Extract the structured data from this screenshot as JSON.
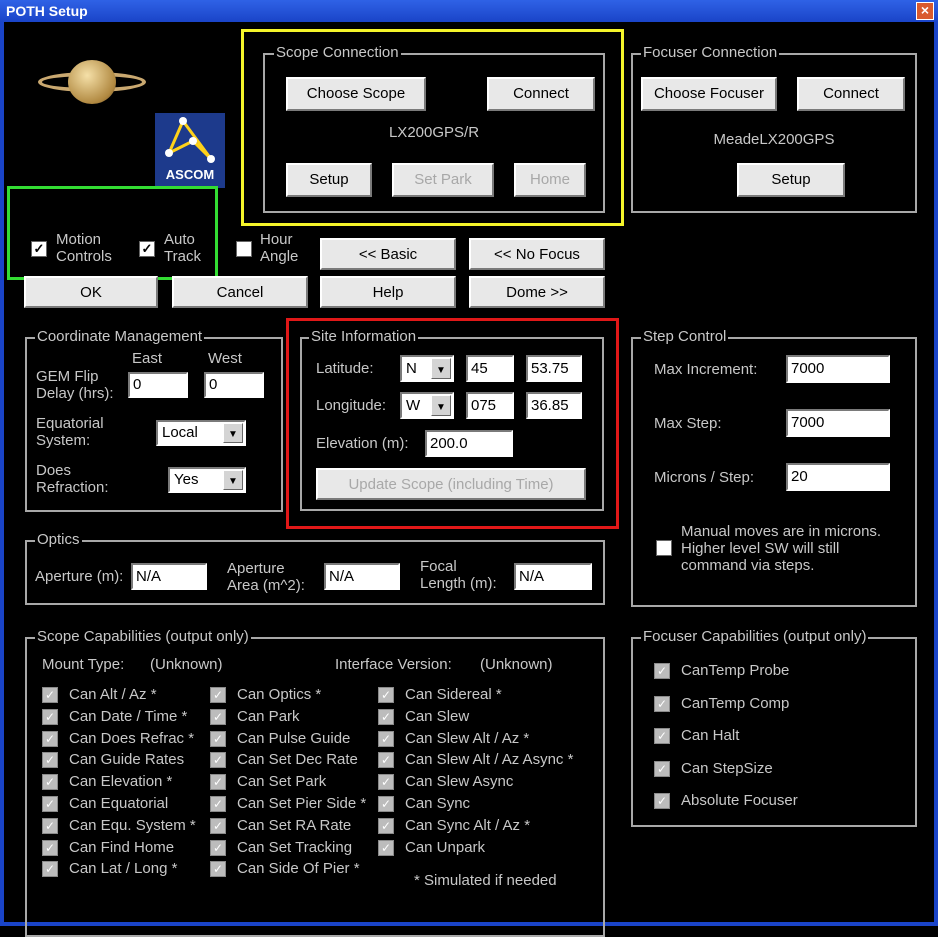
{
  "window": {
    "title": "POTH Setup",
    "close_icon": "close-icon"
  },
  "logo": {
    "ascom_text": "ASCOM"
  },
  "scope_connection": {
    "label": "Scope Connection",
    "choose_scope": "Choose Scope",
    "connect": "Connect",
    "driver": "LX200GPS/R",
    "setup": "Setup",
    "set_park": "Set Park",
    "home": "Home"
  },
  "focuser_connection": {
    "label": "Focuser Connection",
    "choose_focuser": "Choose Focuser",
    "connect": "Connect",
    "driver": "MeadeLX200GPS",
    "setup": "Setup"
  },
  "options": {
    "motion_controls_1": "Motion",
    "motion_controls_2": "Controls",
    "motion_controls_checked": true,
    "auto_track_1": "Auto",
    "auto_track_2": "Track",
    "auto_track_checked": true,
    "hour_angle_1": "Hour",
    "hour_angle_2": "Angle",
    "hour_angle_checked": false
  },
  "buttons": {
    "basic": "<< Basic",
    "no_focus": "<< No Focus",
    "ok": "OK",
    "cancel": "Cancel",
    "help": "Help",
    "dome": "Dome >>"
  },
  "coordinate_management": {
    "label": "Coordinate Management",
    "east": "East",
    "west": "West",
    "gem_flip_1": "GEM Flip",
    "gem_flip_2": "Delay (hrs):",
    "east_value": "0",
    "west_value": "0",
    "equatorial_1": "Equatorial",
    "equatorial_2": "System:",
    "equatorial_value": "Local",
    "refraction_1": "Does",
    "refraction_2": "Refraction:",
    "refraction_value": "Yes"
  },
  "site_information": {
    "label": "Site Information",
    "latitude": "Latitude:",
    "lat_dir": "N",
    "lat_deg": "45",
    "lat_min": "53.75",
    "longitude": "Longitude:",
    "lon_dir": "W",
    "lon_deg": "075",
    "lon_min": "36.85",
    "elevation": "Elevation (m):",
    "elevation_value": "200.0",
    "update_button": "Update Scope (including Time)"
  },
  "step_control": {
    "label": "Step Control",
    "max_increment": "Max Increment:",
    "max_increment_value": "7000",
    "max_step": "Max Step:",
    "max_step_value": "7000",
    "microns_step": "Microns / Step:",
    "microns_step_value": "20",
    "manual_1": "Manual moves are in microns.",
    "manual_2": "Higher level SW will still",
    "manual_3": "command via steps.",
    "manual_checked": false
  },
  "optics": {
    "label": "Optics",
    "aperture": "Aperture (m):",
    "aperture_value": "N/A",
    "area_1": "Aperture",
    "area_2": "Area (m^2):",
    "area_value": "N/A",
    "focal_1": "Focal",
    "focal_2": "Length (m):",
    "focal_value": "N/A"
  },
  "scope_capabilities": {
    "label": "Scope Capabilities  (output only)",
    "mount_type_label": "Mount Type:",
    "mount_type": "(Unknown)",
    "interface_label": "Interface Version:",
    "interface_version": "(Unknown)",
    "col1": [
      "Can Alt / Az *",
      "Can Date / Time *",
      "Can Does Refrac *",
      "Can Guide Rates",
      "Can Elevation *",
      "Can Equatorial",
      "Can Equ. System *",
      "Can Find Home",
      "Can Lat / Long *"
    ],
    "col2": [
      "Can Optics *",
      "Can Park",
      "Can Pulse Guide",
      "Can Set Dec Rate",
      "Can Set Park",
      "Can Set Pier Side *",
      "Can Set RA Rate",
      "Can Set Tracking",
      "Can Side Of Pier *"
    ],
    "col3": [
      "Can Sidereal *",
      "Can Slew",
      "Can Slew Alt / Az *",
      "Can Slew Alt / Az Async *",
      "Can Slew Async",
      "Can Sync",
      "Can Sync Alt / Az *",
      "Can Unpark"
    ],
    "note": "* Simulated if needed"
  },
  "focuser_capabilities": {
    "label": "Focuser Capabilities (output only)",
    "items": [
      "CanTemp Probe",
      "CanTemp Comp",
      "Can Halt",
      "Can StepSize",
      "Absolute Focuser"
    ]
  },
  "highlights": {
    "yellow": "#f5f52a",
    "green": "#33dd33",
    "red": "#e01818"
  }
}
